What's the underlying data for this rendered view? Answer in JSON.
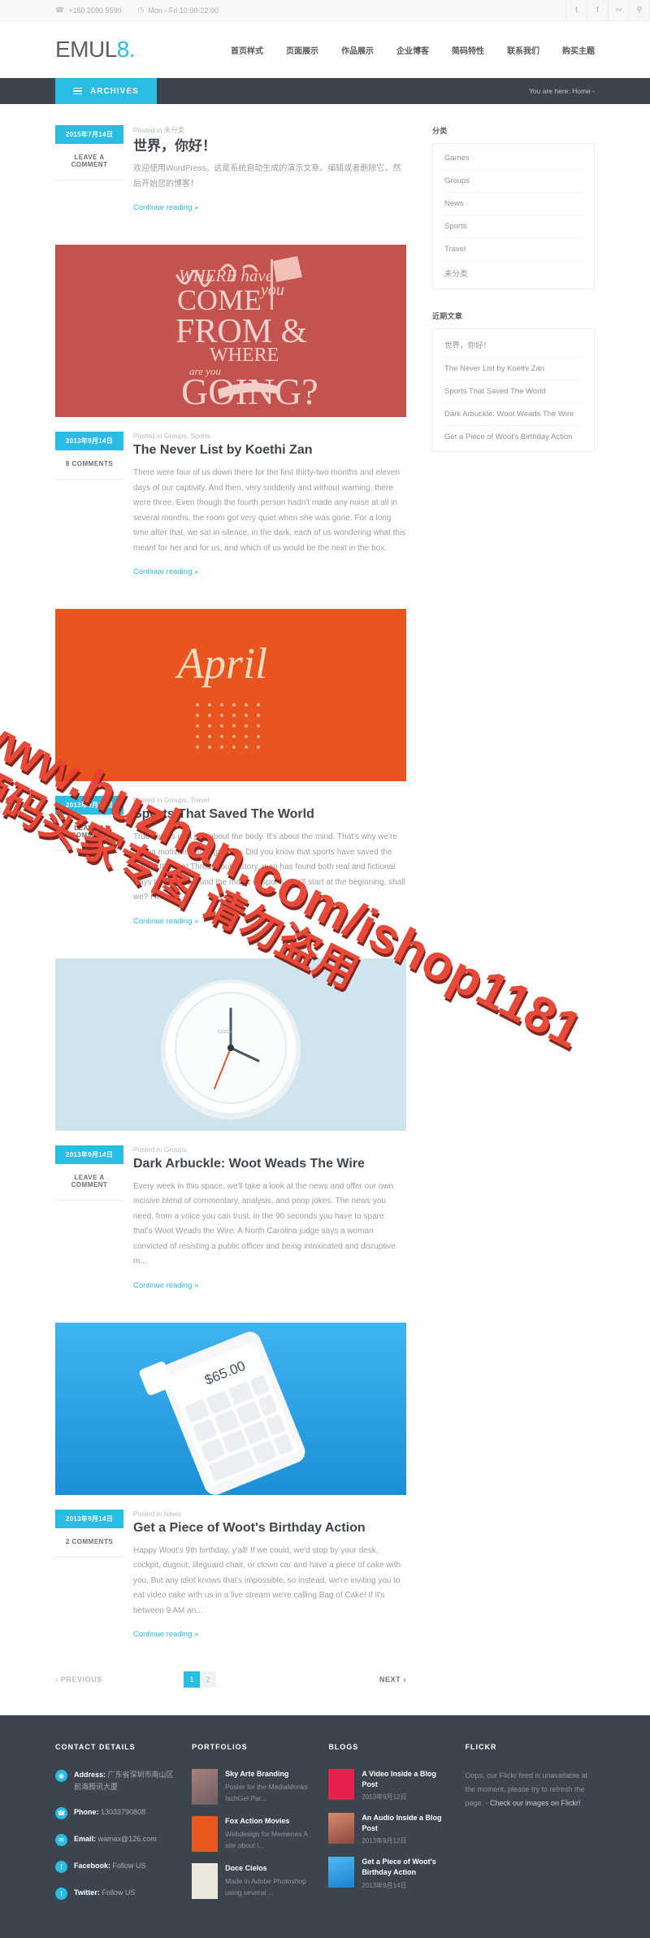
{
  "topbar": {
    "phone": "+180 2090 5590",
    "hours": "Mon - Fri  10:00-22:00",
    "phone_icon": "phone-icon",
    "clock_icon": "clock-icon",
    "social": [
      {
        "name": "tumblr",
        "glyph": "t"
      },
      {
        "name": "facebook",
        "glyph": "f"
      },
      {
        "name": "rss",
        "glyph": "б"
      },
      {
        "name": "search",
        "glyph": "⌕"
      }
    ]
  },
  "header": {
    "logo_main": "EMUL",
    "logo_accent": "8",
    "logo_dot": ".",
    "nav": [
      {
        "label": "首页样式"
      },
      {
        "label": "页面展示"
      },
      {
        "label": "作品展示"
      },
      {
        "label": "企业博客"
      },
      {
        "label": "简码特性"
      },
      {
        "label": "联系我们"
      },
      {
        "label": "购买主题"
      }
    ]
  },
  "subbar": {
    "archives_label": "ARCHIVES",
    "breadcrumb": "You are here: Home -"
  },
  "posts": [
    {
      "date": "2015年7月14日",
      "comments": "LEAVE A COMMENT",
      "posted_in": "Posted in  未分类",
      "title": "世界，你好！",
      "title_lang": "cn",
      "excerpt": "欢迎使用WordPress。这是系统自动生成的演示文章。编辑或者删除它，然后开始您的博客！",
      "more": "Continue reading »",
      "thumb": null
    },
    {
      "date": "2013年9月14日",
      "comments": "8 COMMENTS",
      "posted_in": "Posted in  Groups, Sports",
      "title": "The Never List by Koethi Zan",
      "title_lang": "en",
      "excerpt": "There were four of us down there for the first thirty-two months and eleven days of our captivity. And then, very suddenly and without warning, there were three. Even though the fourth person hadn't made any noise at all in several months, the room got very quiet when she was gone. For a long time after that, we sat in silence, in the dark, each of us wondering what this meant for her and for us, and which of us would be the next in the box.",
      "more": "Continue reading »",
      "thumb": "where-have-you-come-from-poster"
    },
    {
      "date": "2013年9月14日",
      "comments": "LEAVE A COMMENT",
      "posted_in": "Posted in  Groups, Travel",
      "title": "Sports That Saved The World",
      "title_lang": "en",
      "excerpt": "True fitness isn't just about the body. It's about the mind. That's why we're gonna motivate you, right now. Did you know that sports have saved the world? It's true! Throughout history, man has found both real and fictional ways to center around the magic of sports. We'll start at the beginning, shall we? He...",
      "more": "Continue reading »",
      "thumb": "april-lettering-poster"
    },
    {
      "date": "2013年9月14日",
      "comments": "LEAVE A COMMENT",
      "posted_in": "Posted in  Groups",
      "title": "Dark Arbuckle: Woot Weads The Wire",
      "title_lang": "en",
      "excerpt": "Every week in this space, we'll take a look at the news and offer our own incisive blend of commentary, analysis, and poop jokes. The news you need, from a voice you can trust, in the 90 seconds you have to spare: that's Woot Weads the Wire. A North Carolina judge says a woman convicted of resisting a public officer and being intoxicated and disruptive m...",
      "more": "Continue reading »",
      "thumb": "white-wall-clock-photo"
    },
    {
      "date": "2013年9月14日",
      "comments": "2 COMMENTS",
      "posted_in": "Posted in  News",
      "title": "Get a Piece of Woot's Birthday Action",
      "title_lang": "en",
      "excerpt": "Happy Woot's 9th birthday, y'all! If we could, we'd stop by your desk, cockpit, dugout, lifeguard chair, or clown car and have a piece of cake with you. But any idiot knows that's impossible, so instead, we're inviting you to eat video cake with us in a live stream we're calling Bag of Cake! If it's between 9 AM an...",
      "more": "Continue reading »",
      "thumb": "smartphone-calculator-blue"
    }
  ],
  "pagination": {
    "previous": "‹ PREVIOUS",
    "next": "NEXT ›",
    "pages": [
      "1",
      "2"
    ],
    "active": "1"
  },
  "sidebar": {
    "categories_title": "分类",
    "categories": [
      "Games",
      "Groups",
      "News",
      "Sports",
      "Travel",
      "未分类"
    ],
    "recent_title": "近期文章",
    "recent": [
      "世界，你好！",
      "The Never List by Koethi Zan",
      "Sports That Saved The World",
      "Dark Arbuckle: Woot Weads The Wire",
      "Get a Piece of Woot's Birthday Action"
    ]
  },
  "footer": {
    "contact": {
      "title": "CONTACT DETAILS",
      "rows": [
        {
          "icon": "map-pin-icon",
          "glyph": "◉",
          "label": "Address:",
          "value": "广东省深圳市南山区前海腾讯大厦"
        },
        {
          "icon": "phone-icon",
          "glyph": "☎",
          "label": "Phone:",
          "value": "13033790808"
        },
        {
          "icon": "email-icon",
          "glyph": "✉",
          "label": "Email:",
          "value": "wamax@126.com"
        },
        {
          "icon": "facebook-icon",
          "glyph": "f",
          "label": "Facebook:",
          "value": "Follow US"
        },
        {
          "icon": "twitter-icon",
          "glyph": "t",
          "label": "Twitter:",
          "value": "Follow US"
        }
      ]
    },
    "portfolios": {
      "title": "PORTFOLIOS",
      "items": [
        {
          "name": "Sky Arte Branding",
          "desc": "Poster for the MediaMonks IschGel Par...",
          "color": "#9a7a72"
        },
        {
          "name": "Fox Action Movies",
          "desc": "Webdesign for Memenes A site about i...",
          "color": "#e8591f"
        },
        {
          "name": "Doce Cielos",
          "desc": "Made in Adobe Photoshop using several ...",
          "color": "#ece7dd"
        }
      ]
    },
    "blogs": {
      "title": "BLOGS",
      "items": [
        {
          "name": "A Video Inside a Blog Post",
          "date": "2013年9月12日",
          "color": "#e8204f"
        },
        {
          "name": "An Audio Inside a Blog Post",
          "date": "2013年9月12日",
          "color": "#b45a4a"
        },
        {
          "name": "Get a Piece of Woot's Birthday Action",
          "date": "2013年9月14日",
          "color": "#2da6e8"
        }
      ]
    },
    "flickr": {
      "title": "FLICKR",
      "text": "Oops, our Flickr feed is unavailable at the moment, please try to refresh the page. -",
      "link": "Check our images on Flickr!"
    }
  },
  "watermark": {
    "line1": "www.huzhan.com/ishop1181",
    "line2": "源码买家专图  请勿盗用"
  },
  "colors": {
    "accent": "#29bde4",
    "dark": "#3c4450",
    "text": "#8a8f94",
    "watermark": "#e8402f"
  }
}
